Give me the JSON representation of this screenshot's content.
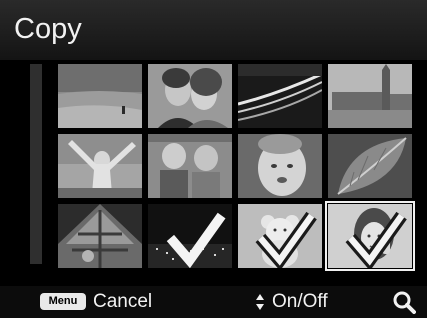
{
  "title": "Copy",
  "footer": {
    "menu_key_label": "Menu",
    "cancel_label": "Cancel",
    "onoff_label": "On/Off",
    "updown_icon": "up-down-arrows-icon",
    "zoom_icon": "magnifier-icon"
  },
  "thumbnails": [
    {
      "subject": "beach-walk",
      "checked": false
    },
    {
      "subject": "couple-portrait",
      "checked": false
    },
    {
      "subject": "night-highway",
      "checked": false
    },
    {
      "subject": "london-big-ben",
      "checked": false
    },
    {
      "subject": "woman-arms-raised",
      "checked": false
    },
    {
      "subject": "two-boys",
      "checked": false
    },
    {
      "subject": "baby-face",
      "checked": false
    },
    {
      "subject": "leaf-closeup",
      "checked": false
    },
    {
      "subject": "playground-tower",
      "checked": false
    },
    {
      "subject": "night-cityscape",
      "checked": true
    },
    {
      "subject": "teddy-bear",
      "checked": true
    },
    {
      "subject": "girl-portrait",
      "checked": true,
      "selected": true
    }
  ],
  "colors": {
    "background": "#000000",
    "title_bar": "#1c1c1c",
    "text": "#f2f2f2",
    "selection": "#f0f0f0"
  }
}
